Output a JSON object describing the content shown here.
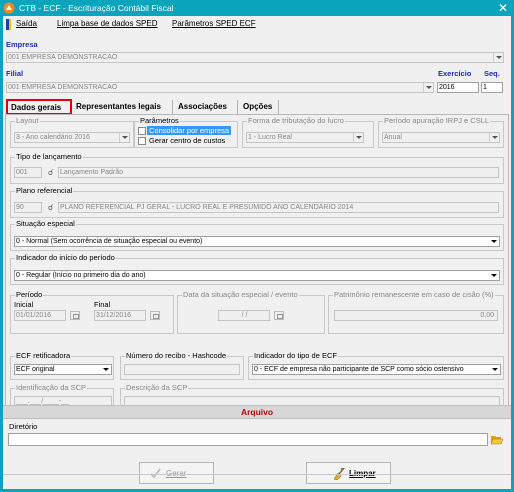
{
  "window": {
    "title": "CTB - ECF - Escrituração Contábil Fiscal",
    "close": "✕"
  },
  "menu": [
    "Saída",
    "Limpa base de dados SPED",
    "Parâmetros SPED ECF"
  ],
  "empresa": {
    "label": "Empresa",
    "value": "001 EMPRESA DEMONSTRACAO"
  },
  "filial": {
    "label": "Filial",
    "value": "001 EMPRESA DEMONSTRACAO"
  },
  "exercicio": {
    "label": "Exercício",
    "value": "2016"
  },
  "seq": {
    "label": "Seq.",
    "value": "1"
  },
  "tabs": [
    "Dados gerais",
    "Representantes legais",
    "Associações",
    "Opções"
  ],
  "layout": {
    "label": "Layout",
    "value": "3 - Ano calendário 2016"
  },
  "parametros": {
    "label": "Parâmetros",
    "consolidar": "Consolidar por empresa",
    "gerar_centro": "Gerar centro de custos"
  },
  "tributacao": {
    "label": "Forma de tributação do lucro",
    "value": "1 - Lucro Real"
  },
  "periodo_apuracao": {
    "label": "Período apuração IRPJ e CSLL",
    "value": "Anual"
  },
  "tipo_lancamento": {
    "label": "Tipo de lançamento",
    "code": "001",
    "desc": "Lançamento Padrão"
  },
  "plano_referencial": {
    "label": "Plano referencial",
    "code": "90",
    "desc": "PLANO REFERENCIAL PJ GERAL - LUCRO REAL E PRESUMIDO ANO CALENDÁRIO 2014"
  },
  "situacao_especial": {
    "label": "Situação especial",
    "value": "0 - Normal (Sem ocorrência de situação especial ou evento)"
  },
  "indicador_inicio": {
    "label": "Indicador do início do período",
    "value": "0 - Regular (Início no primeiro dia do ano)"
  },
  "periodo": {
    "label": "Período",
    "inicial_label": "Inicial",
    "inicial": "01/01/2016",
    "final_label": "Final",
    "final": "31/12/2016"
  },
  "data_situacao": {
    "label": "Data da situação especial / evento",
    "value": "/ /"
  },
  "patrimonio": {
    "label": "Patrimônio remanescente em caso de cisão (%)",
    "value": "0,00"
  },
  "ecf_retificadora": {
    "label": "ECF retificadora",
    "value": "ECF original"
  },
  "numero_recibo": {
    "label": "Número do recibo - Hashcode"
  },
  "indicador_tipo": {
    "label": "Indicador do tipo de ECF",
    "value": "0 - ECF de empresa não participante de SCP como sócio ostensivo"
  },
  "identificacao_scp": {
    "label": "Identificação da SCP",
    "value": "___.___/____-__"
  },
  "descricao_scp": {
    "label": "Descrição da SCP"
  },
  "arquivo": {
    "label": "Arquivo",
    "diretorio_label": "Diretório",
    "diretorio": ""
  },
  "buttons": {
    "gerar": "Gerar",
    "limpar": "Limpar"
  }
}
